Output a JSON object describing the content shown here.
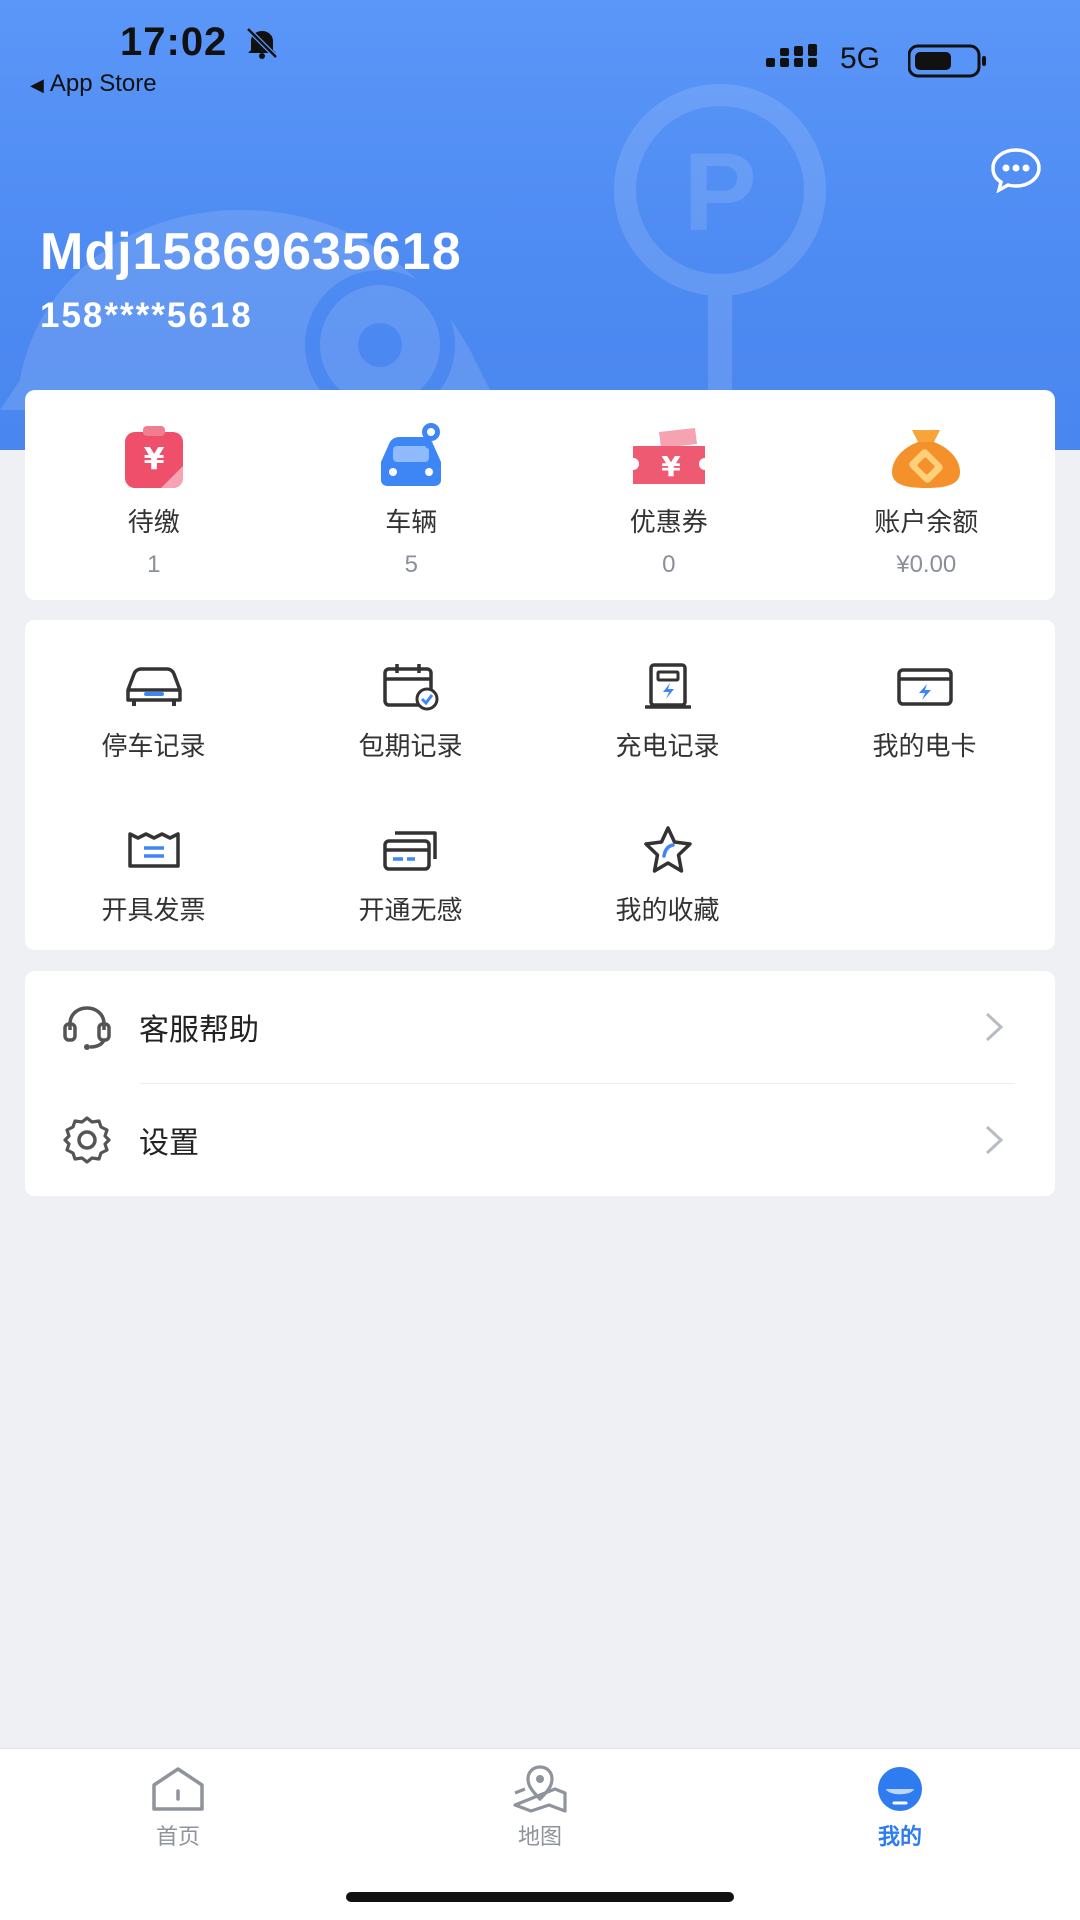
{
  "status_bar": {
    "time": "17:02",
    "back_app": "App Store",
    "network": "5G"
  },
  "profile": {
    "username": "Mdj15869635618",
    "phone": "158****5618"
  },
  "stats": [
    {
      "label": "待缴",
      "value": "1",
      "icon": "bill-icon"
    },
    {
      "label": "车辆",
      "value": "5",
      "icon": "car-icon"
    },
    {
      "label": "优惠券",
      "value": "0",
      "icon": "coupon-icon"
    },
    {
      "label": "账户余额",
      "value": "¥0.00",
      "icon": "money-bag-icon"
    }
  ],
  "services": [
    {
      "label": "停车记录",
      "icon": "car-outline-icon"
    },
    {
      "label": "包期记录",
      "icon": "calendar-check-icon"
    },
    {
      "label": "充电记录",
      "icon": "charging-pile-icon"
    },
    {
      "label": "我的电卡",
      "icon": "electric-card-icon"
    },
    {
      "label": "开具发票",
      "icon": "invoice-icon"
    },
    {
      "label": "开通无感",
      "icon": "cards-icon"
    },
    {
      "label": "我的收藏",
      "icon": "star-icon"
    }
  ],
  "menu": [
    {
      "label": "客服帮助",
      "icon": "headset-icon"
    },
    {
      "label": "设置",
      "icon": "gear-icon"
    }
  ],
  "tabs": [
    {
      "label": "首页",
      "icon": "home-icon",
      "active": false
    },
    {
      "label": "地图",
      "icon": "map-pin-icon",
      "active": false
    },
    {
      "label": "我的",
      "icon": "profile-icon",
      "active": true
    }
  ],
  "colors": {
    "header": "#4d8af2",
    "accent": "#2f7bf0",
    "background": "#eef0f4"
  }
}
